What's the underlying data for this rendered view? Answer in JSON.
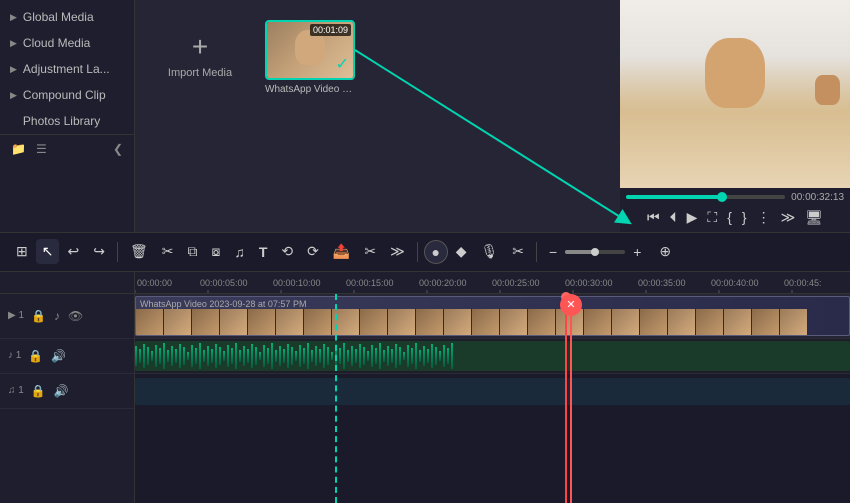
{
  "sidebar": {
    "items": [
      {
        "id": "global-media",
        "label": "Global Media",
        "arrow": "▶"
      },
      {
        "id": "cloud-media",
        "label": "Cloud Media",
        "arrow": "▶"
      },
      {
        "id": "adjustment",
        "label": "Adjustment La...",
        "arrow": "▶"
      },
      {
        "id": "compound-clip",
        "label": "Compound Clip",
        "arrow": "▶"
      },
      {
        "id": "photos-library",
        "label": "Photos Library",
        "arrow": ""
      }
    ]
  },
  "media": {
    "import_label": "Import Media",
    "video_label": "WhatsApp Video 202...",
    "video_duration": "00:01:09"
  },
  "preview": {
    "time": "00:00:32:13"
  },
  "toolbar": {
    "tools": [
      "⊞",
      "↖",
      "↩",
      "↪",
      "🗑",
      "✂",
      "⧉",
      "⧇",
      "♫",
      "T",
      "⟳",
      "⟲",
      "📤",
      "✂",
      "≫",
      "⊙",
      "⊡",
      "🎙",
      "✂",
      "⊕",
      "🖥"
    ]
  },
  "timeline": {
    "time_marks": [
      "00:00:00",
      "00:00:05:00",
      "00:00:10:00",
      "00:00:15:00",
      "00:00:20:00",
      "00:00:25:00",
      "00:00:30:00",
      "00:00:35:00",
      "00:00:40:00",
      "00:00:45:"
    ],
    "tracks": [
      {
        "type": "video",
        "num": "1",
        "label": "WhatsApp Video 2023-09-28 at 07:57 PM"
      },
      {
        "type": "audio",
        "num": "1"
      },
      {
        "type": "music",
        "num": "1"
      }
    ],
    "playhead_pos": "00:00:30:00",
    "cut_pos": "00:00:30:00"
  },
  "icons": {
    "arrow_right": "▶",
    "scissors": "✂",
    "plus": "+",
    "folder": "📁",
    "eye": "👁",
    "mute": "🔇",
    "lock": "🔒",
    "speaker": "🔊",
    "music": "♪",
    "add": "⊕",
    "minus": "−",
    "check": "✓",
    "close": "✕",
    "undo": "↩",
    "redo": "↪",
    "delete": "⌫",
    "split": "⧉",
    "play": "▶",
    "rewind": "⏮",
    "step_back": "⏴",
    "step_fwd": "⏵",
    "fullscreen": "⛶"
  },
  "colors": {
    "accent": "#00d4b0",
    "playhead": "#ff4444",
    "cut_marker": "#ff5555",
    "sidebar_bg": "#1e1e2e",
    "toolbar_bg": "#1a1a2a",
    "timeline_bg": "#1a1a2a"
  }
}
